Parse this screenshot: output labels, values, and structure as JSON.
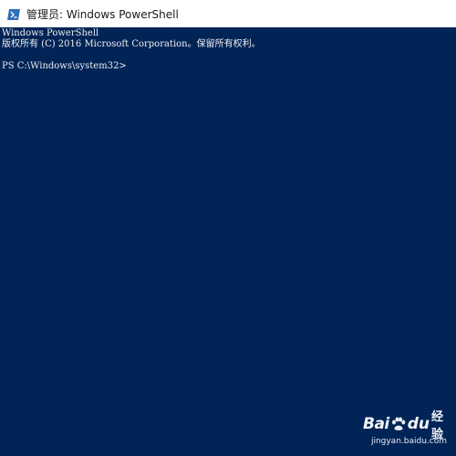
{
  "window": {
    "title": "管理员: Windows PowerShell",
    "icon": "powershell-icon"
  },
  "console": {
    "lines": [
      "Windows PowerShell",
      "版权所有 (C) 2016 Microsoft Corporation。保留所有权利。",
      "",
      "PS C:\\Windows\\system32>"
    ]
  },
  "watermark": {
    "brand_left": "Bai",
    "brand_right": "du",
    "brand_cn": "经验",
    "url": "jingyan.baidu.com",
    "icon": "paw-icon"
  },
  "colors": {
    "console_background": "#012456",
    "console_text": "#eeedf0",
    "titlebar_background": "#ffffff"
  }
}
